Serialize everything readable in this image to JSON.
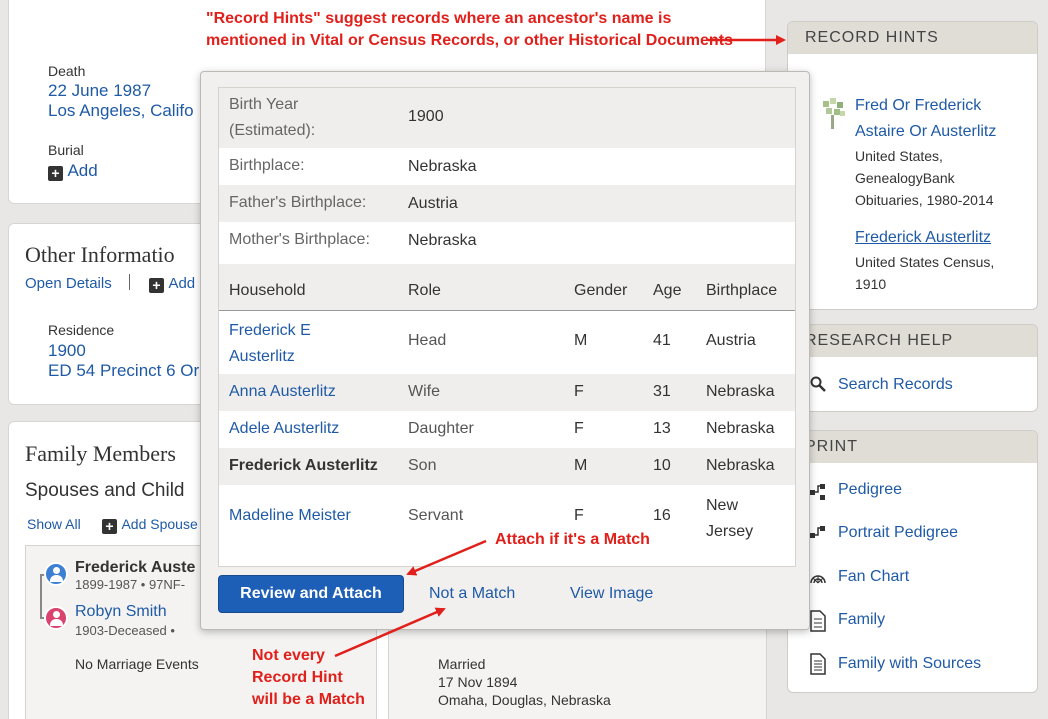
{
  "vitals": {
    "death_label": "Death",
    "death_date": "22 June 1987",
    "death_place": "Los Angeles, Califo",
    "burial_label": "Burial",
    "burial_add": "Add"
  },
  "other_info": {
    "title": "Other Informatio",
    "open_details": "Open Details",
    "add": "Add",
    "residence_label": "Residence",
    "residence_year": "1900",
    "residence_place": "ED 54 Precinct 6 Or"
  },
  "family": {
    "title": "Family Members",
    "subtitle": "Spouses and Child",
    "show_all": "Show All",
    "add_spouse": "Add Spouse",
    "person1_name": "Frederick Auste",
    "person1_dates": "1899-1987 • 97NF-",
    "person2_name": "Robyn Smith",
    "person2_dates": "1903-Deceased •",
    "no_marriage": "No Marriage Events",
    "married_label": "Married",
    "married_date": "17 Nov 1894",
    "married_place": "Omaha, Douglas, Nebraska"
  },
  "popup": {
    "facts": [
      {
        "key_line1": "Birth Year",
        "key_line2": "(Estimated):",
        "value": "1900"
      },
      {
        "key_line1": "Birthplace:",
        "key_line2": "",
        "value": "Nebraska"
      },
      {
        "key_line1": "Father's Birthplace:",
        "key_line2": "",
        "value": "Austria"
      },
      {
        "key_line1": "Mother's Birthplace:",
        "key_line2": "",
        "value": "Nebraska"
      }
    ],
    "headers": {
      "household": "Household",
      "role": "Role",
      "gender": "Gender",
      "age": "Age",
      "birthplace": "Birthplace"
    },
    "rows": [
      {
        "name_line1": "Frederick E",
        "name_line2": "Austerlitz",
        "role": "Head",
        "gender": "M",
        "age": "41",
        "birthplace_line1": "Austria",
        "birthplace_line2": ""
      },
      {
        "name_line1": "Anna Austerlitz",
        "name_line2": "",
        "role": "Wife",
        "gender": "F",
        "age": "31",
        "birthplace_line1": "Nebraska",
        "birthplace_line2": ""
      },
      {
        "name_line1": "Adele Austerlitz",
        "name_line2": "",
        "role": "Daughter",
        "gender": "F",
        "age": "13",
        "birthplace_line1": "Nebraska",
        "birthplace_line2": ""
      },
      {
        "name_line1": "Frederick Austerlitz",
        "name_line2": "",
        "role": "Son",
        "gender": "M",
        "age": "10",
        "birthplace_line1": "Nebraska",
        "birthplace_line2": ""
      },
      {
        "name_line1": "Madeline Meister",
        "name_line2": "",
        "role": "Servant",
        "gender": "F",
        "age": "16",
        "birthplace_line1": "New",
        "birthplace_line2": "Jersey"
      }
    ],
    "review_attach": "Review and Attach",
    "not_match": "Not a Match",
    "view_image": "View Image"
  },
  "record_hints": {
    "title": "RECORD HINTS",
    "hint1_title_line1": "Fred Or Frederick",
    "hint1_title_line2": "Astaire Or Austerlitz",
    "hint1_desc_line1": "United States,",
    "hint1_desc_line2": "GenealogyBank",
    "hint1_desc_line3": "Obituaries, 1980-2014",
    "hint2_title": "Frederick Austerlitz",
    "hint2_desc_line1": "United States Census,",
    "hint2_desc_line2": "1910"
  },
  "research_help": {
    "title": "RESEARCH HELP",
    "search_records": "Search Records"
  },
  "print": {
    "title": "PRINT",
    "items": [
      "Pedigree",
      "Portrait Pedigree",
      "Fan Chart",
      "Family",
      "Family with Sources"
    ]
  },
  "annotations": {
    "record_hints_line1": "\"Record Hints\" suggest records where an ancestor's name is",
    "record_hints_line2": "mentioned in Vital or Census Records, or other Historical Documents",
    "attach": "Attach if it's a Match",
    "not_every_line1": "Not every",
    "not_every_line2": "Record Hint",
    "not_every_line3": "will be a Match"
  },
  "colors": {
    "link": "#1f5aa6",
    "primary_button": "#1d5eb6",
    "annotation": "#e1201b",
    "panel_header": "#e0ddd7"
  }
}
